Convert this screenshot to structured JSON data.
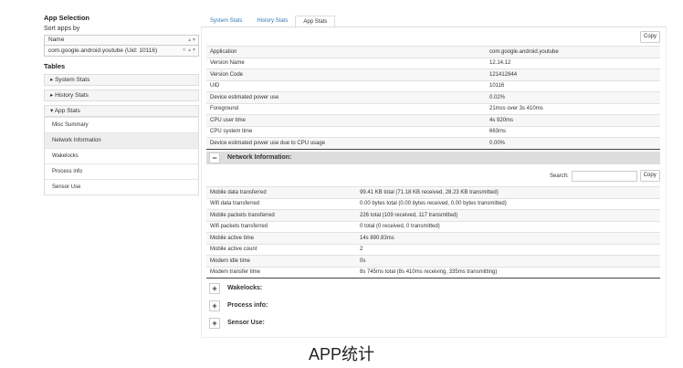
{
  "sidebar": {
    "title": "App Selection",
    "sort_label": "Sort apps by",
    "sort_value": "Name",
    "app_value": "com.google.android.youtube (Uid: 10116)",
    "tables_label": "Tables",
    "sections": [
      "System Stats",
      "History Stats",
      "App Stats"
    ],
    "items": [
      "Misc Summary",
      "Network Information",
      "Wakelocks",
      "Process info",
      "Sensor Use"
    ]
  },
  "tabs": [
    "System Stats",
    "History Stats",
    "App Stats"
  ],
  "copy_label": "Copy",
  "app_table": [
    [
      "Application",
      "com.google.android.youtube"
    ],
    [
      "Version Name",
      "12.14.12"
    ],
    [
      "Version Code",
      "121412844"
    ],
    [
      "UID",
      "10116"
    ],
    [
      "Device estimated power use",
      "0.02%"
    ],
    [
      "Foreground",
      "21mss over 3s 410ms"
    ],
    [
      "CPU user time",
      "4s 920ms"
    ],
    [
      "CPU system time",
      "663ms"
    ],
    [
      "Device estimated power use due to CPU usage",
      "0.00%"
    ]
  ],
  "network": {
    "title": "Network Information:",
    "search_label": "Search:",
    "search_value": "",
    "copy_label": "Copy",
    "rows": [
      [
        "Mobile data transferred",
        "99.41 KB total (71.18 KB received, 28.23 KB transmitted)"
      ],
      [
        "Wifi data transferred",
        "0.00 bytes total (0.00 bytes received, 0.00 bytes transmitted)"
      ],
      [
        "Mobile packets transferred",
        "226 total (109 received, 117 transmitted)"
      ],
      [
        "Wifi packets transferred",
        "0 total (0 received, 0 transmitted)"
      ],
      [
        "Mobile active time",
        "14s 890.83ms"
      ],
      [
        "Mobile active count",
        "2"
      ],
      [
        "Modem idle time",
        "0s"
      ],
      [
        "Modem transfer time",
        "8s 745ms total (8s 410ms receiving, 335ms transmitting)"
      ]
    ]
  },
  "collapsed": [
    "Wakelocks:",
    "Process info:",
    "Sensor Use:"
  ],
  "caption": "APP统计"
}
